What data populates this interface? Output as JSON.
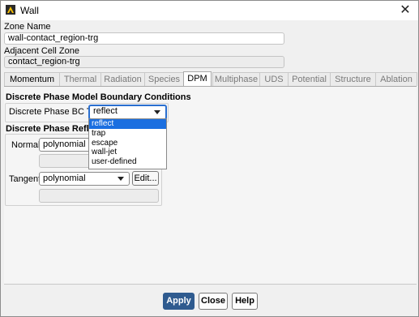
{
  "window": {
    "title": "Wall",
    "icon": "ansys-fluent-icon"
  },
  "zone": {
    "name_label": "Zone Name",
    "name_value": "wall-contact_region-trg",
    "adjacent_label": "Adjacent Cell Zone",
    "adjacent_value": "contact_region-trg"
  },
  "tabs": [
    {
      "label": "Momentum"
    },
    {
      "label": "Thermal"
    },
    {
      "label": "Radiation"
    },
    {
      "label": "Species"
    },
    {
      "label": "DPM"
    },
    {
      "label": "Multiphase"
    },
    {
      "label": "UDS"
    },
    {
      "label": "Potential"
    },
    {
      "label": "Structure"
    },
    {
      "label": "Ablation"
    }
  ],
  "active_tab": "DPM",
  "dpm": {
    "section_title": "Discrete Phase Model Boundary Conditions",
    "bc_type_label": "Discrete Phase BC Type",
    "bc_type_value": "reflect",
    "bc_type_options": [
      "reflect",
      "trap",
      "escape",
      "wall-jet",
      "user-defined"
    ],
    "reflection_title": "Discrete Phase Reflec",
    "normal_label": "Normal",
    "normal_value": "polynomial",
    "tangent_label": "Tangent",
    "tangent_value": "polynomial",
    "edit_label": "Edit..."
  },
  "footer": {
    "apply": "Apply",
    "close": "Close",
    "help": "Help"
  },
  "colors": {
    "accent": "#1b6fe0",
    "primary_button": "#2f5b8f"
  }
}
